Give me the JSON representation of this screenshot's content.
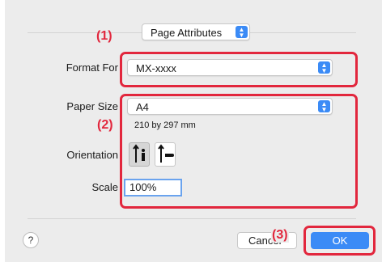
{
  "header": {
    "panel_select": "Page Attributes"
  },
  "format_for": {
    "label": "Format For",
    "value": "MX-xxxx"
  },
  "paper_size": {
    "label": "Paper Size",
    "value": "A4",
    "dimensions": "210 by 297 mm"
  },
  "orientation": {
    "label": "Orientation",
    "selected": "portrait"
  },
  "scale": {
    "label": "Scale",
    "value": "100%"
  },
  "footer": {
    "help": "?",
    "cancel": "Cancel",
    "ok": "OK"
  },
  "callouts": {
    "one": "(1)",
    "two": "(2)",
    "three": "(3)"
  },
  "colors": {
    "accent": "#3b8bf6",
    "callout": "#e2273d"
  }
}
